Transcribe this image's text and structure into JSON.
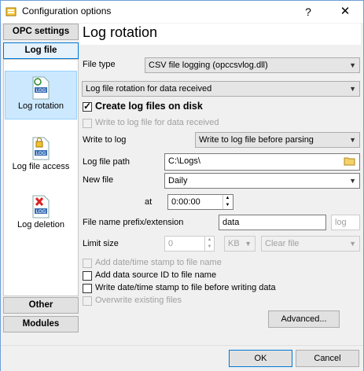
{
  "window": {
    "title": "Configuration options",
    "help": "?",
    "close": "✕"
  },
  "categories": {
    "opc_settings": "OPC settings",
    "log_file": "Log file",
    "other": "Other",
    "modules": "Modules"
  },
  "sidebar": {
    "items": [
      {
        "label": "Log rotation",
        "icon": "log-rotation-icon"
      },
      {
        "label": "Log file access",
        "icon": "log-lock-icon"
      },
      {
        "label": "Log deletion",
        "icon": "log-delete-icon"
      }
    ],
    "icon_text": "LOG"
  },
  "page": {
    "title": "Log rotation"
  },
  "form": {
    "file_type_label": "File type",
    "file_type_value": "CSV file logging (opccsvlog.dll)",
    "rotation_value": "Log file rotation for data received",
    "create_log_files": "Create log files on disk",
    "write_for_data": "Write to log file for data received",
    "write_to_log_label": "Write to log",
    "write_to_log_value": "Write to log file before parsing",
    "log_path_label": "Log file path",
    "log_path_value": "C:\\Logs\\",
    "new_file_label": "New file",
    "new_file_value": "Daily",
    "at_label": "at",
    "at_value": "0:00:00",
    "prefix_label": "File name prefix/extension",
    "prefix_value": "data",
    "extension_value": "log",
    "limit_label": "Limit size",
    "limit_value": "0",
    "limit_unit": "KB",
    "limit_action": "Clear file",
    "add_datetime_stamp": "Add date/time stamp to file name",
    "add_source_id": "Add data source ID to file name",
    "write_datetime_stamp": "Write date/time stamp to file before writing data",
    "overwrite_existing": "Overwrite existing files",
    "advanced_button": "Advanced..."
  },
  "footer": {
    "ok": "OK",
    "cancel": "Cancel"
  },
  "colors": {
    "selection_bg": "#cce8ff",
    "accent": "#0078d7"
  }
}
